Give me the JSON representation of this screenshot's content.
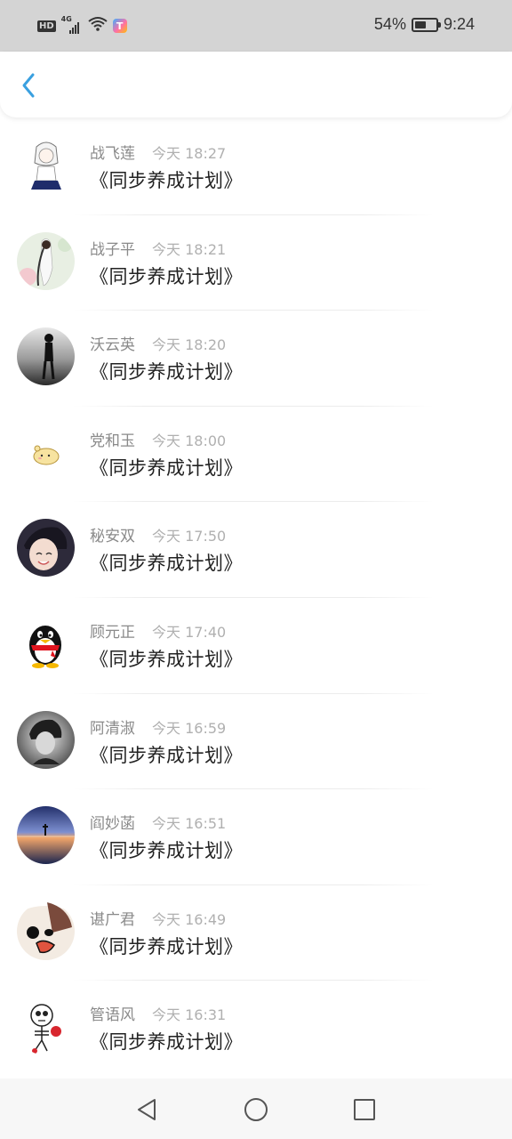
{
  "status_bar": {
    "hd": "HD",
    "net": "4G",
    "app_icon": "T",
    "battery": "54%",
    "battery_level": 0.54,
    "time": "9:24"
  },
  "header": {
    "back_icon": "chevron-left-icon"
  },
  "colors": {
    "accent": "#3aa0e0",
    "name": "#8a8a8a",
    "time": "#b0b0b0",
    "text": "#222222"
  },
  "messages": [
    {
      "name": "战飞莲",
      "time": "今天 18:27",
      "text": "《同步养成计划》"
    },
    {
      "name": "战子平",
      "time": "今天 18:21",
      "text": "《同步养成计划》"
    },
    {
      "name": "沃云英",
      "time": "今天 18:20",
      "text": "《同步养成计划》"
    },
    {
      "name": "党和玉",
      "time": "今天 18:00",
      "text": "《同步养成计划》"
    },
    {
      "name": "秘安双",
      "time": "今天 17:50",
      "text": "《同步养成计划》"
    },
    {
      "name": "顾元正",
      "time": "今天 17:40",
      "text": "《同步养成计划》"
    },
    {
      "name": "阿清淑",
      "time": "今天 16:59",
      "text": "《同步养成计划》"
    },
    {
      "name": "阎妙菡",
      "time": "今天 16:51",
      "text": "《同步养成计划》"
    },
    {
      "name": "谌广君",
      "time": "今天 16:49",
      "text": "《同步养成计划》"
    },
    {
      "name": "管语风",
      "time": "今天 16:31",
      "text": "《同步养成计划》"
    }
  ],
  "bottom_nav": [
    "back-triangle-icon",
    "home-circle-icon",
    "recents-square-icon"
  ]
}
